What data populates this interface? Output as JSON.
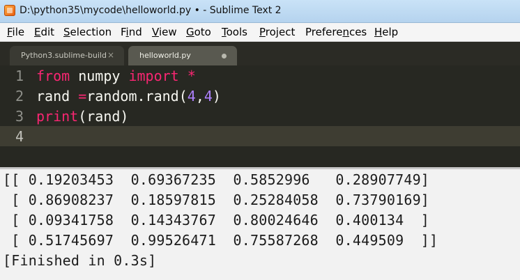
{
  "window": {
    "title": "D:\\python35\\mycode\\helloworld.py • - Sublime Text 2"
  },
  "menu": [
    {
      "label": "File",
      "mnemonic": "F",
      "rest": "ile"
    },
    {
      "label": "Edit",
      "mnemonic": "E",
      "rest": "dit"
    },
    {
      "label": "Selection",
      "mnemonic": "S",
      "rest": "election"
    },
    {
      "label": "Find",
      "pre": "F",
      "mnemonic": "i",
      "rest": "nd"
    },
    {
      "label": "View",
      "mnemonic": "V",
      "rest": "iew"
    },
    {
      "label": "Goto",
      "mnemonic": "G",
      "rest": "oto"
    },
    {
      "label": "Tools",
      "mnemonic": "T",
      "rest": "ools"
    },
    {
      "label": "Project",
      "mnemonic": "P",
      "rest": "roject"
    },
    {
      "label": "Preferences",
      "pre": "Prefere",
      "mnemonic": "n",
      "rest": "ces"
    },
    {
      "label": "Help",
      "mnemonic": "H",
      "rest": "elp"
    }
  ],
  "tabs": [
    {
      "label": "Python3.sublime-build",
      "close": "×"
    },
    {
      "label": "helloworld.py"
    }
  ],
  "editor": {
    "line_numbers": [
      "1",
      "2",
      "3",
      "4"
    ],
    "lines": [
      [
        {
          "t": "from",
          "c": "kw"
        },
        {
          "t": " numpy ",
          "c": "fn"
        },
        {
          "t": "import",
          "c": "kw"
        },
        {
          "t": " ",
          "c": "fn"
        },
        {
          "t": "*",
          "c": "kw"
        }
      ],
      [
        {
          "t": "rand ",
          "c": "fn"
        },
        {
          "t": "=",
          "c": "kw"
        },
        {
          "t": "random.rand(",
          "c": "fn"
        },
        {
          "t": "4",
          "c": "num"
        },
        {
          "t": ",",
          "c": "fn"
        },
        {
          "t": "4",
          "c": "num"
        },
        {
          "t": ")",
          "c": "fn"
        }
      ],
      [
        {
          "t": "print",
          "c": "kw"
        },
        {
          "t": "(rand)",
          "c": "fn"
        }
      ],
      []
    ]
  },
  "output": {
    "lines": [
      "[[ 0.19203453  0.69367235  0.5852996   0.28907749]",
      " [ 0.86908237  0.18597815  0.25284058  0.73790169]",
      " [ 0.09341758  0.14343767  0.80024646  0.400134  ]",
      " [ 0.51745697  0.99526471  0.75587268  0.449509  ]]",
      "[Finished in 0.3s]"
    ]
  },
  "colors": {
    "editor_bg": "#272822",
    "keyword": "#f92672",
    "number": "#ae81ff",
    "text": "#f8f8f2",
    "gutter": "#8f908a"
  }
}
